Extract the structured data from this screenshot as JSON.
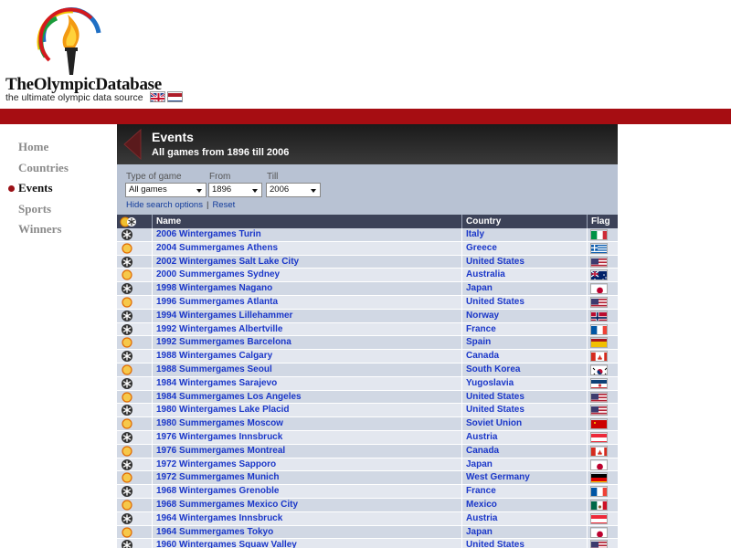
{
  "header": {
    "brand": "TheOlympicDatabase",
    "tagline": "the ultimate olympic data source",
    "languages": [
      "english-flag",
      "dutch-flag"
    ]
  },
  "colors": {
    "accent_red": "#a60d12",
    "link_blue": "#1a37c9",
    "panel_bg": "#d1d8e4"
  },
  "nav": {
    "items": [
      {
        "label": "Home",
        "active": false
      },
      {
        "label": "Countries",
        "active": false
      },
      {
        "label": "Events",
        "active": true
      },
      {
        "label": "Sports",
        "active": false
      },
      {
        "label": "Winners",
        "active": false
      }
    ]
  },
  "banner": {
    "title": "Events",
    "subtitle": "All games from 1896 till 2006"
  },
  "search": {
    "type_label": "Type of game",
    "type_value": "All games",
    "from_label": "From",
    "from_value": "1896",
    "till_label": "Till",
    "till_value": "2006",
    "hide_link": "Hide search options",
    "reset_link": "Reset"
  },
  "table": {
    "columns": {
      "name": "Name",
      "country": "Country",
      "flag": "Flag"
    },
    "rows": [
      {
        "type": "winter",
        "name": "2006 Wintergames Turin",
        "country": "Italy",
        "flag": "it"
      },
      {
        "type": "summer",
        "name": "2004 Summergames Athens",
        "country": "Greece",
        "flag": "gr"
      },
      {
        "type": "winter",
        "name": "2002 Wintergames Salt Lake City",
        "country": "United States",
        "flag": "us"
      },
      {
        "type": "summer",
        "name": "2000 Summergames Sydney",
        "country": "Australia",
        "flag": "au"
      },
      {
        "type": "winter",
        "name": "1998 Wintergames Nagano",
        "country": "Japan",
        "flag": "jp"
      },
      {
        "type": "summer",
        "name": "1996 Summergames Atlanta",
        "country": "United States",
        "flag": "us"
      },
      {
        "type": "winter",
        "name": "1994 Wintergames Lillehammer",
        "country": "Norway",
        "flag": "no"
      },
      {
        "type": "winter",
        "name": "1992 Wintergames Albertville",
        "country": "France",
        "flag": "fr"
      },
      {
        "type": "summer",
        "name": "1992 Summergames Barcelona",
        "country": "Spain",
        "flag": "es"
      },
      {
        "type": "winter",
        "name": "1988 Wintergames Calgary",
        "country": "Canada",
        "flag": "ca"
      },
      {
        "type": "summer",
        "name": "1988 Summergames Seoul",
        "country": "South Korea",
        "flag": "kr"
      },
      {
        "type": "winter",
        "name": "1984 Wintergames Sarajevo",
        "country": "Yugoslavia",
        "flag": "yu"
      },
      {
        "type": "summer",
        "name": "1984 Summergames Los Angeles",
        "country": "United States",
        "flag": "us"
      },
      {
        "type": "winter",
        "name": "1980 Wintergames Lake Placid",
        "country": "United States",
        "flag": "us"
      },
      {
        "type": "summer",
        "name": "1980 Summergames Moscow",
        "country": "Soviet Union",
        "flag": "su"
      },
      {
        "type": "winter",
        "name": "1976 Wintergames Innsbruck",
        "country": "Austria",
        "flag": "at"
      },
      {
        "type": "summer",
        "name": "1976 Summergames Montreal",
        "country": "Canada",
        "flag": "ca"
      },
      {
        "type": "winter",
        "name": "1972 Wintergames Sapporo",
        "country": "Japan",
        "flag": "jp"
      },
      {
        "type": "summer",
        "name": "1972 Summergames Munich",
        "country": "West Germany",
        "flag": "de"
      },
      {
        "type": "winter",
        "name": "1968 Wintergames Grenoble",
        "country": "France",
        "flag": "fr"
      },
      {
        "type": "summer",
        "name": "1968 Summergames Mexico City",
        "country": "Mexico",
        "flag": "mx"
      },
      {
        "type": "winter",
        "name": "1964 Wintergames Innsbruck",
        "country": "Austria",
        "flag": "at"
      },
      {
        "type": "summer",
        "name": "1964 Summergames Tokyo",
        "country": "Japan",
        "flag": "jp"
      },
      {
        "type": "winter",
        "name": "1960 Wintergames Squaw Valley",
        "country": "United States",
        "flag": "us"
      }
    ]
  }
}
